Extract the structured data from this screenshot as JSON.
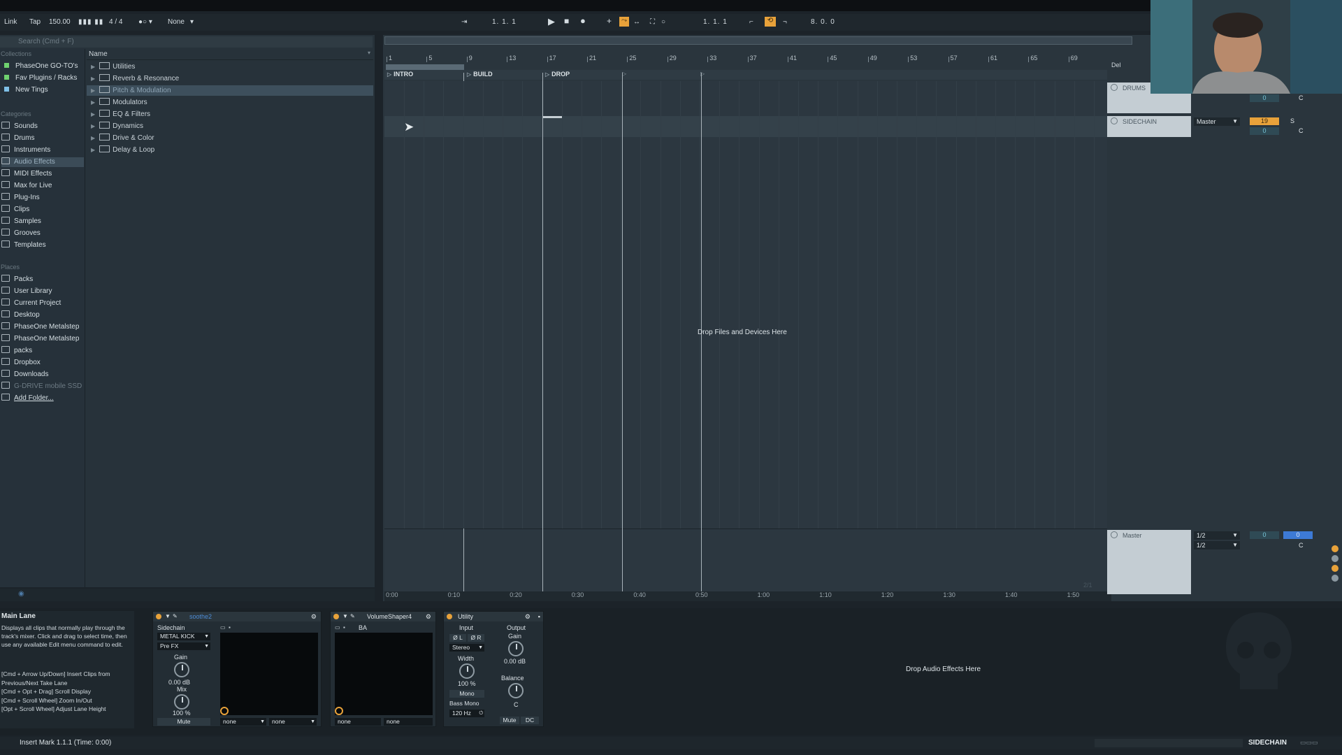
{
  "control_bar": {
    "link": "Link",
    "tap": "Tap",
    "tempo": "150.00",
    "signature": "4 / 4",
    "quantize": "None",
    "position": "1.  1.  1",
    "loop_start": "1.  1.  1",
    "loop_length": "8.  0.  0"
  },
  "browser": {
    "search_placeholder": "Search (Cmd + F)",
    "collections_header": "Collections",
    "collections": [
      "PhaseOne GO-TO's",
      "Fav Plugins / Racks",
      "New Tings"
    ],
    "categories_header": "Categories",
    "categories": [
      "Sounds",
      "Drums",
      "Instruments",
      "Audio Effects",
      "MIDI Effects",
      "Max for Live",
      "Plug-Ins",
      "Clips",
      "Samples",
      "Grooves",
      "Templates"
    ],
    "places_header": "Places",
    "places": [
      "Packs",
      "User Library",
      "Current Project",
      "Desktop",
      "PhaseOne Metalstep",
      "PhaseOne Metalstep",
      "packs",
      "Dropbox",
      "Downloads",
      "G-DRIVE mobile SSD",
      "Add Folder..."
    ],
    "column_name": "Name",
    "folders": [
      "Utilities",
      "Reverb & Resonance",
      "Pitch & Modulation",
      "Modulators",
      "EQ & Filters",
      "Dynamics",
      "Drive & Color",
      "Delay & Loop"
    ]
  },
  "arrangement": {
    "bars": [
      "1",
      "5",
      "9",
      "13",
      "17",
      "21",
      "25",
      "29",
      "33",
      "37",
      "41",
      "45",
      "49",
      "53",
      "57",
      "61",
      "65",
      "69"
    ],
    "locators": [
      "INTRO",
      "BUILD",
      "DROP"
    ],
    "drop_text": "Drop Files and Devices Here",
    "times": [
      "0:00",
      "0:10",
      "0:20",
      "0:30",
      "0:40",
      "0:50",
      "1:00",
      "1:10",
      "1:20",
      "1:30",
      "1:40",
      "1:50"
    ],
    "page": "2/1"
  },
  "tracks": {
    "del": "Del",
    "drums": {
      "name": "DRUMS",
      "vol": "0",
      "pan": "C"
    },
    "sidechain": {
      "name": "SIDECHAIN",
      "output": "Master",
      "vol": "19",
      "send": "S",
      "vol2": "0",
      "pan": "C"
    },
    "master": {
      "name": "Master",
      "out1": "1/2",
      "out2": "1/2",
      "vol": "0",
      "vol2": "0",
      "pan": "C"
    }
  },
  "info": {
    "title": "Main Lane",
    "body": "Displays all clips that normally play through the track's mixer. Click and drag to select time, then use any available Edit menu command to edit.",
    "keys": [
      "[Cmd + Arrow Up/Down] Insert Clips from Previous/Next Take Lane",
      "[Cmd + Opt + Drag] Scroll Display",
      "[Cmd + Scroll Wheel] Zoom In/Out",
      "[Opt + Scroll Wheel] Adjust Lane Height"
    ]
  },
  "devices": {
    "soothe": {
      "name": "soothe2",
      "sidechain": "Sidechain",
      "source": "METAL KICK",
      "tap": "Pre FX",
      "gain_label": "Gain",
      "gain": "0.00 dB",
      "mix_label": "Mix",
      "mix": "100 %",
      "mute": "Mute",
      "sel1": "none",
      "sel2": "none"
    },
    "volshaper": {
      "name": "VolumeShaper4",
      "preset": "BA",
      "sel1": "none",
      "sel2": "none"
    },
    "utility": {
      "name": "Utility",
      "input": "Input",
      "output": "Output",
      "phase_l": "Ø L",
      "phase_r": "Ø R",
      "stereo": "Stereo",
      "gain_label": "Gain",
      "gain": "0.00 dB",
      "width_label": "Width",
      "width": "100 %",
      "balance_label": "Balance",
      "balance": "C",
      "mono": "Mono",
      "bass_mono": "Bass Mono",
      "bass_freq": "120 Hz",
      "mute": "Mute",
      "dc": "DC"
    },
    "drop_text": "Drop Audio Effects Here"
  },
  "status": {
    "text": "Insert Mark 1.1.1 (Time: 0:00)",
    "track": "SIDECHAIN"
  },
  "colors": {
    "accent": "#e8a23a",
    "selection": "#3d4f5c",
    "background": "#1c2329"
  }
}
